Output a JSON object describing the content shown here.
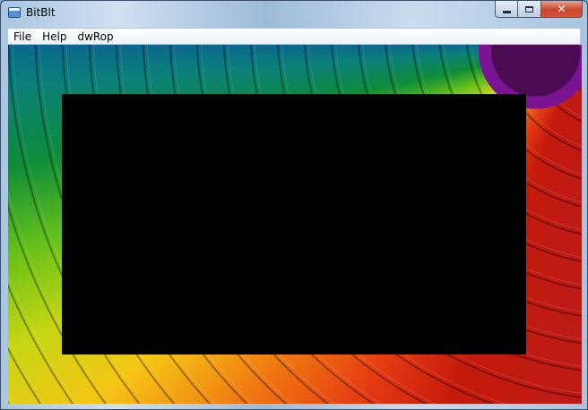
{
  "window": {
    "title": "BitBlt"
  },
  "caption_buttons": {
    "minimize_icon": "minimize-icon",
    "maximize_icon": "maximize-icon",
    "close_icon": "close-icon",
    "close_glyph": "✕"
  },
  "menu": {
    "items": [
      "File",
      "Help",
      "dwRop"
    ]
  },
  "colors": {
    "title_bar": "#a9c6e2",
    "close_button": "#c7452c",
    "canvas_rect": "#000000"
  }
}
